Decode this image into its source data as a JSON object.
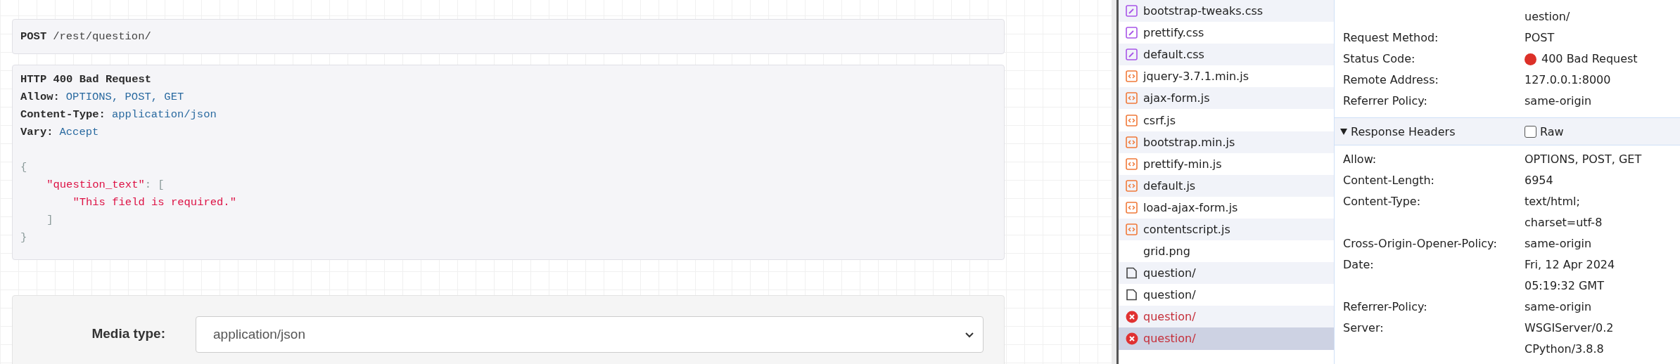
{
  "request_line": {
    "method": "POST",
    "path": "/rest/question/"
  },
  "response": {
    "status_line": "HTTP 400 Bad Request",
    "headers": [
      {
        "name": "Allow:",
        "value": "OPTIONS, POST, GET"
      },
      {
        "name": "Content-Type:",
        "value": "application/json"
      },
      {
        "name": "Vary:",
        "value": "Accept"
      }
    ],
    "body": [
      {
        "tokens": [
          {
            "kind": "punct",
            "text": "{"
          }
        ]
      },
      {
        "tokens": [
          {
            "kind": "string",
            "text": "    \"question_text\""
          },
          {
            "kind": "punct",
            "text": ": ["
          }
        ]
      },
      {
        "tokens": [
          {
            "kind": "string",
            "text": "        \"This field is required.\""
          }
        ]
      },
      {
        "tokens": [
          {
            "kind": "punct",
            "text": "    ]"
          }
        ]
      },
      {
        "tokens": [
          {
            "kind": "punct",
            "text": "}"
          }
        ]
      }
    ]
  },
  "form": {
    "label": "Media type:",
    "select_value": "application/json"
  },
  "devtools": {
    "files": [
      {
        "name": "bootstrap-tweaks.css",
        "kind": "css",
        "error": false,
        "selected": false
      },
      {
        "name": "prettify.css",
        "kind": "css",
        "error": false,
        "selected": false
      },
      {
        "name": "default.css",
        "kind": "css",
        "error": false,
        "selected": false
      },
      {
        "name": "jquery-3.7.1.min.js",
        "kind": "js",
        "error": false,
        "selected": false
      },
      {
        "name": "ajax-form.js",
        "kind": "js",
        "error": false,
        "selected": false
      },
      {
        "name": "csrf.js",
        "kind": "js",
        "error": false,
        "selected": false
      },
      {
        "name": "bootstrap.min.js",
        "kind": "js",
        "error": false,
        "selected": false
      },
      {
        "name": "prettify-min.js",
        "kind": "js",
        "error": false,
        "selected": false
      },
      {
        "name": "default.js",
        "kind": "js",
        "error": false,
        "selected": false
      },
      {
        "name": "load-ajax-form.js",
        "kind": "js",
        "error": false,
        "selected": false
      },
      {
        "name": "contentscript.js",
        "kind": "js",
        "error": false,
        "selected": false
      },
      {
        "name": "grid.png",
        "kind": "image",
        "error": false,
        "selected": false
      },
      {
        "name": "question/",
        "kind": "document",
        "error": false,
        "selected": false
      },
      {
        "name": "question/",
        "kind": "document",
        "error": false,
        "selected": false
      },
      {
        "name": "question/",
        "kind": "error",
        "error": true,
        "selected": false
      },
      {
        "name": "question/",
        "kind": "error",
        "error": true,
        "selected": true
      }
    ],
    "general": [
      {
        "values": [
          "uestion/"
        ]
      },
      {
        "label": "Request Method:",
        "values": [
          "POST"
        ]
      },
      {
        "label": "Status Code:",
        "values": [
          "400 Bad Request"
        ],
        "color": "#dc3028"
      },
      {
        "label": "Remote Address:",
        "values": [
          "127.0.0.1:8000"
        ]
      },
      {
        "label": "Referrer Policy:",
        "values": [
          "same-origin"
        ]
      }
    ],
    "response_section": {
      "title": "Response Headers",
      "expanded": true,
      "raw_label": "Raw",
      "raw_checked": false
    },
    "response_headers": [
      {
        "label": "Allow:",
        "values": [
          "OPTIONS, POST, GET"
        ]
      },
      {
        "label": "Content-Length:",
        "values": [
          "6954"
        ]
      },
      {
        "label": "Content-Type:",
        "values": [
          "text/html;",
          "charset=utf-8"
        ]
      },
      {
        "label": "Cross-Origin-Opener-Policy:",
        "values": [
          "same-origin"
        ]
      },
      {
        "label": "Date:",
        "values": [
          "Fri, 12 Apr 2024",
          "05:19:32 GMT"
        ]
      },
      {
        "label": "Referrer-Policy:",
        "values": [
          "same-origin"
        ]
      },
      {
        "label": "Server:",
        "values": [
          "WSGIServer/0.2",
          "CPython/3.8.8"
        ]
      }
    ]
  }
}
